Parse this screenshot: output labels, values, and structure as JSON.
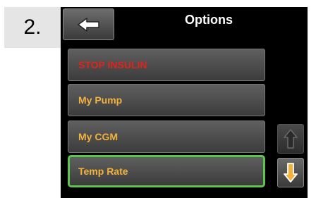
{
  "step": {
    "label": "2."
  },
  "header": {
    "title": "Options",
    "back_icon": "left-arrow-icon"
  },
  "menu": {
    "items": [
      {
        "label": "STOP INSULIN",
        "color": "#e0241b"
      },
      {
        "label": "My Pump",
        "color": "#f3b23c"
      },
      {
        "label": "My CGM",
        "color": "#f3b23c"
      },
      {
        "label": "Temp Rate",
        "color": "#f3b23c",
        "selected": true
      }
    ]
  },
  "scroll": {
    "up_icon": "up-arrow-icon",
    "down_icon": "down-arrow-icon",
    "up_enabled": false,
    "down_enabled": true
  },
  "colors": {
    "accent_selected": "#5dc44f",
    "label_orange": "#f3b23c",
    "label_red": "#e0241b",
    "screen_bg": "#000000"
  }
}
